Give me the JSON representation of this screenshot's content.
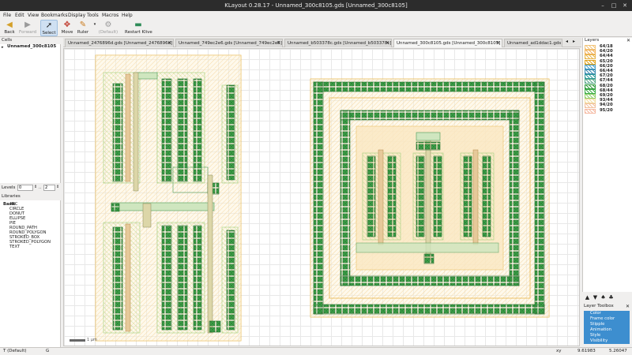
{
  "window": {
    "title": "KLayout 0.28.17 - Unnamed_300c8105.gds [Unnamed_300c8105]"
  },
  "menu": [
    "File",
    "Edit",
    "View",
    "Bookmarks",
    "Display",
    "Tools",
    "Macros",
    "Help"
  ],
  "toolbar": {
    "back": "Back",
    "forward": "Forward",
    "select": "Select",
    "move": "Move",
    "ruler": "Ruler",
    "default": "(Default)",
    "restart": "Restart Klive"
  },
  "cells": {
    "header": "Cells",
    "top": "Unnamed_300c8105"
  },
  "levels": {
    "label": "Levels",
    "from": "0",
    "to": "2"
  },
  "libraries": {
    "header": "Libraries",
    "root": "Basic",
    "items": [
      "ARC",
      "CIRCLE",
      "DONUT",
      "ELLIPSE",
      "PIE",
      "ROUND_PATH",
      "ROUND_POLYGON",
      "STROKED_BOX",
      "STROKED_POLYGON",
      "TEXT"
    ]
  },
  "tabs": [
    "Unnamed_2476896d.gds [Unnamed_2476896d]",
    "Unnamed_749ec2e6.gds [Unnamed_749ec2e6]",
    "Unnamed_b503378c.gds [Unnamed_b503378c]",
    "Unnamed_300c8105.gds [Unnamed_300c8105]",
    "Unnamed_ad1ddac1.gds"
  ],
  "scale": "1 µm",
  "layers": {
    "header": "Layers",
    "items": [
      {
        "name": "64/18",
        "color": "#f2c47a"
      },
      {
        "name": "64/20",
        "color": "#f0b25c"
      },
      {
        "name": "64/44",
        "color": "#e8b64c"
      },
      {
        "name": "65/20",
        "color": "#e0a21c"
      },
      {
        "name": "66/20",
        "color": "#4aa0c8"
      },
      {
        "name": "66/44",
        "color": "#3a8ab0"
      },
      {
        "name": "67/20",
        "color": "#2f9a9a"
      },
      {
        "name": "67/44",
        "color": "#5aa88a"
      },
      {
        "name": "68/20",
        "color": "#2e9a3c"
      },
      {
        "name": "68/44",
        "color": "#3fae4a"
      },
      {
        "name": "69/20",
        "color": "#8fcf6a"
      },
      {
        "name": "93/44",
        "color": "#f2dca0"
      },
      {
        "name": "94/20",
        "color": "#f2c2a0"
      },
      {
        "name": "95/20",
        "color": "#f5b8a0"
      }
    ]
  },
  "layer_toolbox": {
    "header": "Layer Toolbox",
    "items": [
      "Color",
      "Frame color",
      "Stipple",
      "Animation",
      "Style",
      "Visibility"
    ]
  },
  "status": {
    "mode": "T (Default)",
    "g": "G",
    "xy_label": "xy",
    "x": "9.61983",
    "y": "5.26047"
  }
}
